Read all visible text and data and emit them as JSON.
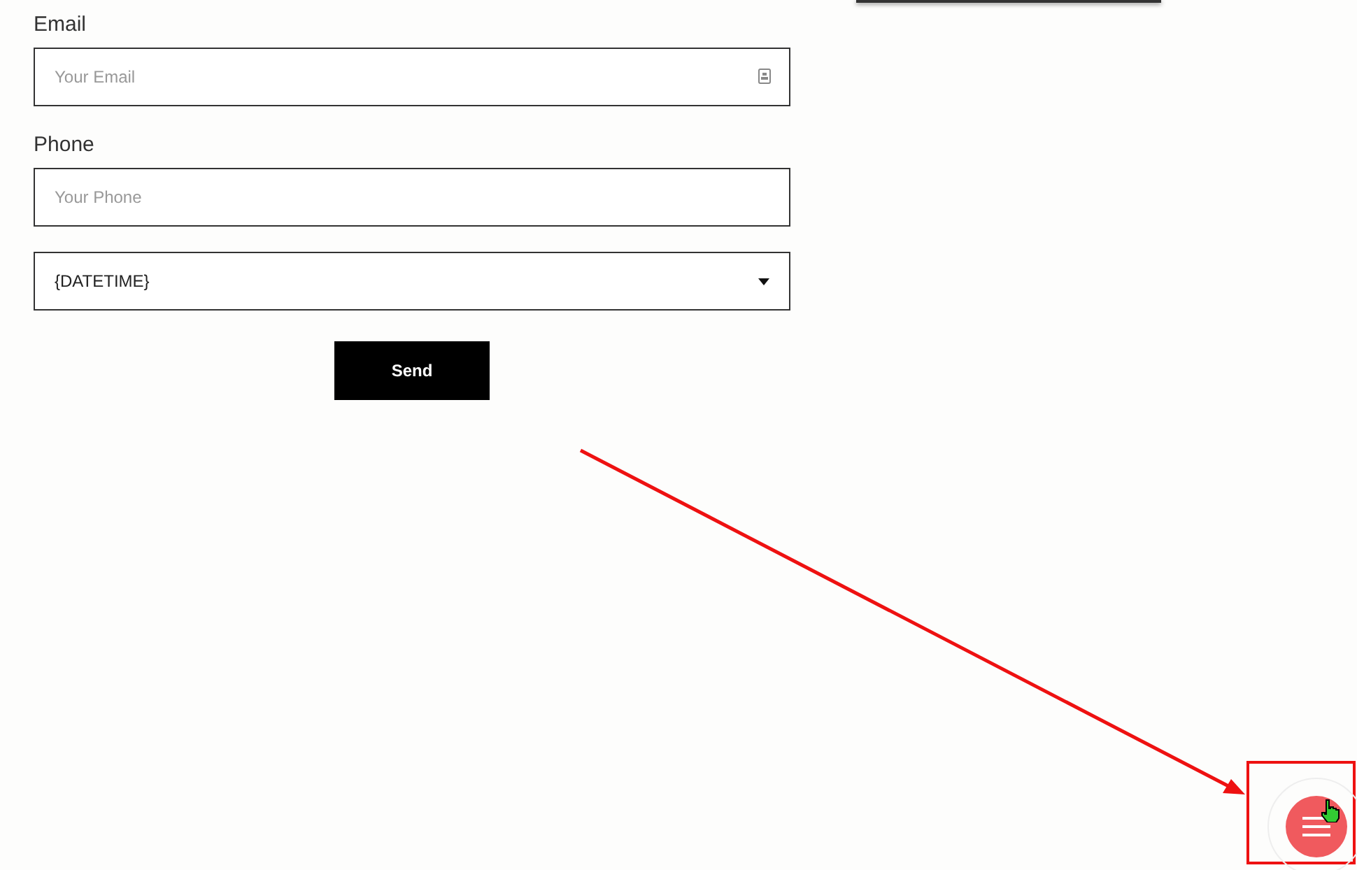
{
  "form": {
    "fields": [
      {
        "kind": "input",
        "label": "Email",
        "placeholder": "Your Email",
        "icon": true
      },
      {
        "kind": "input",
        "label": "Phone",
        "placeholder": "Your Phone",
        "icon": false
      },
      {
        "kind": "select",
        "value": "{DATETIME}"
      }
    ],
    "submit": "Send"
  }
}
